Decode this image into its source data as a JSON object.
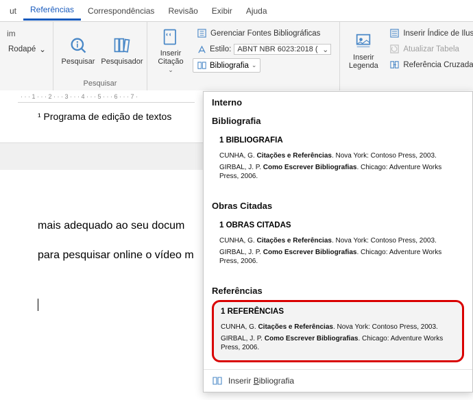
{
  "tabs": {
    "ut": "ut",
    "referencias": "Referências",
    "correspondencias": "Correspondências",
    "revisao": "Revisão",
    "exibir": "Exibir",
    "ajuda": "Ajuda"
  },
  "ribbon": {
    "group1": {
      "top_partial": "im",
      "rodape": "Rodapé",
      "caret": "⌄"
    },
    "pesquisar_group": {
      "label": "Pesquisar",
      "pesquisar": "Pesquisar",
      "pesquisador": "Pesquisador"
    },
    "cit_group": {
      "inserir_citacao": "Inserir\nCitação",
      "gerenciar": "Gerenciar Fontes Bibliográficas",
      "estilo_label": "Estilo:",
      "estilo_value": "ABNT NBR 6023:2018 (",
      "bibliografia": "Bibliografia"
    },
    "legenda_group": {
      "inserir_legenda": "Inserir\nLegenda",
      "inserir_indice": "Inserir Índice de Ilustr",
      "atualizar_tabela": "Atualizar Tabela",
      "ref_cruzada": "Referência Cruzada"
    }
  },
  "ruler_marks": [
    "1",
    "·",
    "2",
    "·",
    "3",
    "·",
    "4",
    "·",
    "5",
    "·",
    "6",
    "·",
    "7"
  ],
  "doc": {
    "footnote": "¹ Programa de edição de textos",
    "body1": "mais adequado ao seu docum",
    "body2": "para pesquisar online o vídeo m"
  },
  "dropdown": {
    "interno": "Interno",
    "sections": [
      {
        "category": "Bibliografia",
        "heading": "1   BIBLIOGRAFIA",
        "entries": [
          {
            "author": "CUNHA, G.",
            "title": "Citações e Referências",
            "rest": ". Nova York: Contoso Press, 2003."
          },
          {
            "author": "GIRBAL, J. P.",
            "title": "Como Escrever Bibliografias",
            "rest": ". Chicago: Adventure Works Press, 2006."
          }
        ]
      },
      {
        "category": "Obras Citadas",
        "heading": "1   OBRAS CITADAS",
        "entries": [
          {
            "author": "CUNHA, G.",
            "title": "Citações e Referências",
            "rest": ". Nova York: Contoso Press, 2003."
          },
          {
            "author": "GIRBAL, J. P.",
            "title": "Como Escrever Bibliografias",
            "rest": ". Chicago: Adventure Works Press, 2006."
          }
        ]
      },
      {
        "category": "Referências",
        "heading": "1   REFERÊNCIAS",
        "entries": [
          {
            "author": "CUNHA, G.",
            "title": "Citações e Referências",
            "rest": ". Nova York: Contoso Press, 2003."
          },
          {
            "author": "GIRBAL, J. P.",
            "title": "Como Escrever Bibliografias",
            "rest": ". Chicago: Adventure Works Press, 2006."
          }
        ]
      }
    ],
    "footer_text_pre": "Inserir ",
    "footer_text_u": "B",
    "footer_text_post": "ibliografia"
  }
}
